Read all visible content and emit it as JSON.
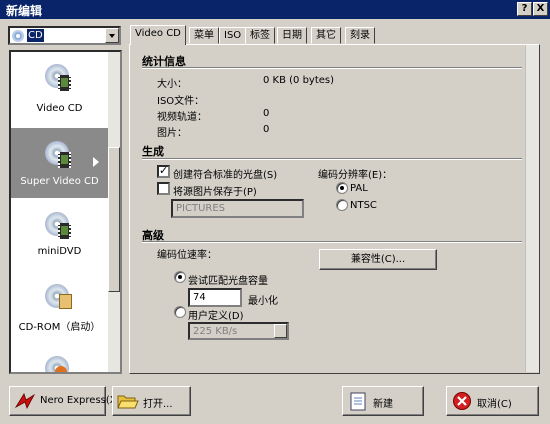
{
  "window": {
    "title": "新编辑",
    "help": "?",
    "close": "X"
  },
  "disc_type": {
    "selected": "CD"
  },
  "projects": [
    {
      "label": "Video CD"
    },
    {
      "label": "Super Video CD"
    },
    {
      "label": "miniDVD"
    },
    {
      "label": "CD-ROM（启动）"
    }
  ],
  "tabs": [
    {
      "label": "Video CD"
    },
    {
      "label": "菜单"
    },
    {
      "label": "ISO"
    },
    {
      "label": "标签"
    },
    {
      "label": "日期"
    },
    {
      "label": "其它"
    },
    {
      "label": "刻录"
    }
  ],
  "stats": {
    "heading": "统计信息",
    "size_label": "大小：",
    "size_value": "0 KB (0 bytes)",
    "iso_label": "ISO文件：",
    "video_label": "视频轨道：",
    "video_value": "0",
    "pics_label": "图片：",
    "pics_value": "0"
  },
  "generate": {
    "heading": "生成",
    "create_label": "创建符合标准的光盘(S)",
    "save_label": "将源图片保存于(P)",
    "folder_value": "PICTURES",
    "resolution_label": "编码分辨率(E)：",
    "pal_label": "PAL",
    "ntsc_label": "NTSC"
  },
  "advanced": {
    "heading": "高级",
    "bitrate_label": "编码位速率：",
    "compat_button": "兼容性(C)...",
    "fit_label": "尝试匹配光盘容量",
    "fit_value": "74",
    "min_label": "最小化",
    "custom_label": "用户定义(D)",
    "custom_value": "225 KB/s"
  },
  "buttons": {
    "nero_express": "Nero Express(X)",
    "open": "打开...",
    "new": "新建",
    "cancel": "取消(C)"
  }
}
